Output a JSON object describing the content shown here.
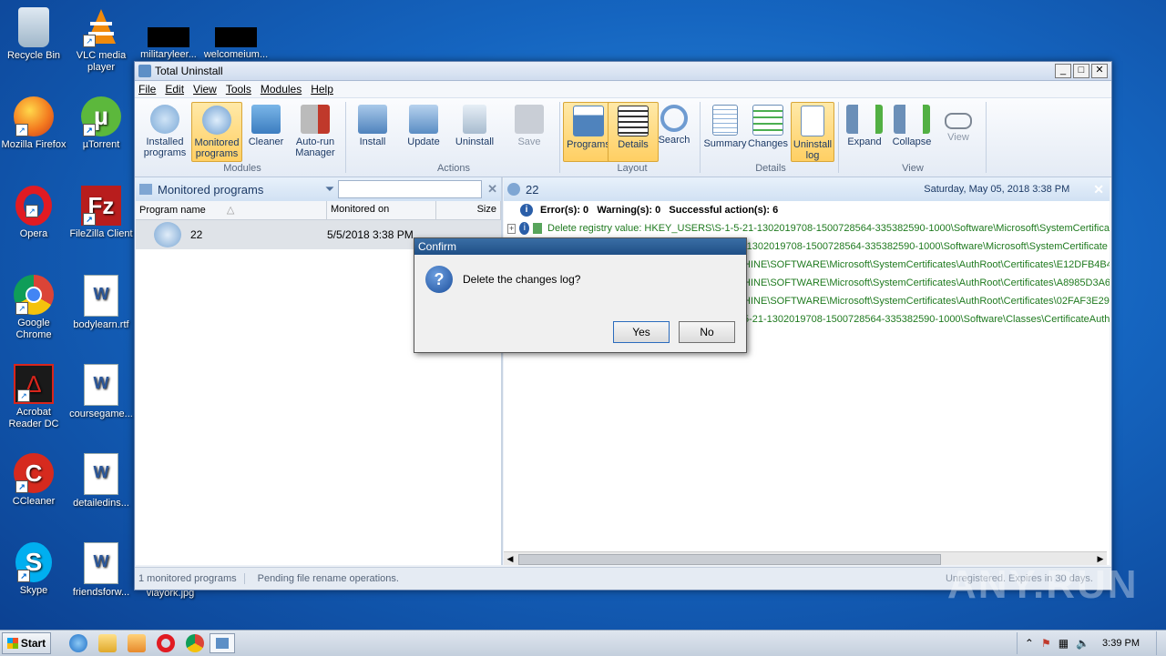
{
  "desktop": {
    "icons": [
      {
        "label": "Recycle Bin"
      },
      {
        "label": "VLC media player"
      },
      {
        "label": "militaryleer..."
      },
      {
        "label": "welcomeium..."
      },
      {
        "label": "Mozilla Firefox"
      },
      {
        "label": "µTorrent"
      },
      {
        "label": "Opera"
      },
      {
        "label": "FileZilla Client"
      },
      {
        "label": "Google Chrome"
      },
      {
        "label": "bodylearn.rtf"
      },
      {
        "label": "Acrobat Reader DC"
      },
      {
        "label": "coursegame..."
      },
      {
        "label": "CCleaner"
      },
      {
        "label": "detailedins..."
      },
      {
        "label": "Skype"
      },
      {
        "label": "friendsforw..."
      },
      {
        "label": "viayork.jpg"
      }
    ]
  },
  "window": {
    "title": "Total Uninstall",
    "menu": [
      "File",
      "Edit",
      "View",
      "Tools",
      "Modules",
      "Help"
    ],
    "ribbon": {
      "modules": [
        "Installed programs",
        "Monitored programs",
        "Cleaner",
        "Auto-run Manager"
      ],
      "actions": [
        "Install",
        "Update",
        "Uninstall",
        "Save"
      ],
      "layout": [
        "Programs",
        "Details",
        "Search"
      ],
      "details": [
        "Summary",
        "Changes",
        "Uninstall log"
      ],
      "view": [
        "Expand",
        "Collapse",
        "View"
      ],
      "groups": [
        "Modules",
        "Actions",
        "Layout",
        "Details",
        "View"
      ]
    },
    "left_panel": {
      "title": "Monitored programs",
      "columns": [
        "Program name",
        "Monitored on",
        "Size"
      ],
      "rows": [
        {
          "name": "22",
          "monitored_on": "5/5/2018 3:38 PM"
        }
      ]
    },
    "right_panel": {
      "title": "22",
      "date": "Saturday, May 05, 2018 3:38 PM",
      "summary": "Error(s): 0   Warning(s): 0   Successful action(s): 6",
      "log": [
        "Delete registry value: HKEY_USERS\\S-1-5-21-1302019708-1500728564-335382590-1000\\Software\\Microsoft\\SystemCertifica",
        "-1302019708-1500728564-335382590-1000\\Software\\Microsoft\\SystemCertificate",
        "HINE\\SOFTWARE\\Microsoft\\SystemCertificates\\AuthRoot\\Certificates\\E12DFB4B4",
        "HINE\\SOFTWARE\\Microsoft\\SystemCertificates\\AuthRoot\\Certificates\\A8985D3A6",
        "HINE\\SOFTWARE\\Microsoft\\SystemCertificates\\AuthRoot\\Certificates\\02FAF3E29",
        "5-21-1302019708-1500728564-335382590-1000\\Software\\Classes\\CertificateAuth"
      ]
    },
    "status": {
      "left": "1 monitored programs",
      "middle": "Pending file rename operations.",
      "right": "Unregistered. Expires in 30 days."
    }
  },
  "dialog": {
    "title": "Confirm",
    "message": "Delete the changes log?",
    "yes": "Yes",
    "no": "No"
  },
  "taskbar": {
    "start": "Start",
    "clock": "3:39 PM"
  },
  "watermark": "ANY.RUN",
  "colors": {
    "accent": "#1f4f86",
    "selected": "#ffcf63",
    "log_green": "#1f7a1f"
  }
}
